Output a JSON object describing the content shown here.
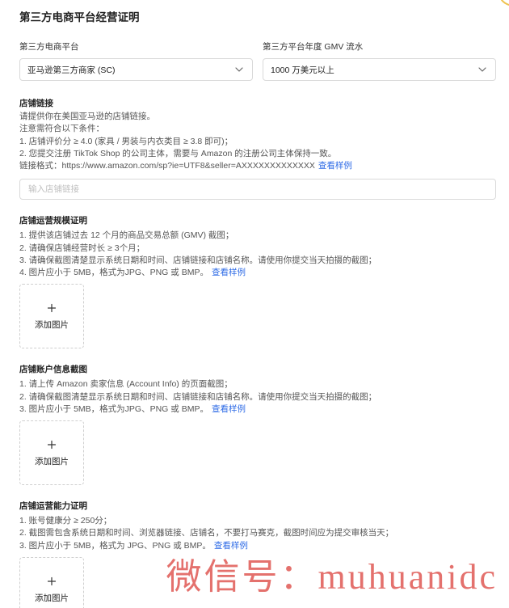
{
  "page": {
    "title": "第三方电商平台经营证明"
  },
  "platform_field": {
    "label": "第三方电商平台",
    "selected": "亚马逊第三方商家 (SC)",
    "icon": "chevron-down-icon"
  },
  "gmv_field": {
    "label": "第三方平台年度 GMV 流水",
    "selected": "1000 万美元以上",
    "icon": "chevron-down-icon"
  },
  "store_link": {
    "title": "店铺链接",
    "lines": [
      "请提供你在美国亚马逊的店铺链接。",
      "注意需符合以下条件：",
      "1. 店铺评价分 ≥ 4.0 (家具 / 男装与内衣类目 ≥ 3.8 即可)；",
      "2. 您提交注册 TikTok Shop 的公司主体，需要与 Amazon 的注册公司主体保持一致。"
    ],
    "format_line": "链接格式：https://www.amazon.com/sp?ie=UTF8&seller=AXXXXXXXXXXXXX",
    "sample_link": "查看样例",
    "input_placeholder": "输入店铺链接"
  },
  "scale_proof": {
    "title": "店铺运营规模证明",
    "lines": [
      "1. 提供该店铺过去 12 个月的商品交易总额 (GMV) 截图；",
      "2. 请确保店铺经营时长 ≥ 3个月；",
      "3. 请确保截图清楚显示系统日期和时间、店铺链接和店铺名称。请使用你提交当天拍摄的截图；"
    ],
    "last_line": "4. 图片应小于 5MB，格式为JPG、PNG 或 BMP。",
    "sample_link": "查看样例",
    "upload": {
      "icon": "plus-icon",
      "label": "添加图片"
    }
  },
  "account_info": {
    "title": "店铺账户信息截图",
    "lines": [
      "1. 请上传 Amazon 卖家信息 (Account Info) 的页面截图；",
      "2. 请确保截图清楚显示系统日期和时间、店铺链接和店铺名称。请使用你提交当天拍摄的截图；"
    ],
    "last_line": "3. 图片应小于 5MB，格式为JPG、PNG 或 BMP。",
    "sample_link": "查看样例",
    "upload": {
      "icon": "plus-icon",
      "label": "添加图片"
    }
  },
  "capability_proof": {
    "title": "店铺运营能力证明",
    "lines": [
      "1. 账号健康分 ≥ 250分；",
      "2. 截图需包含系统日期和时间、浏览器链接、店铺名，不要打马赛克，截图时间应为提交审核当天；"
    ],
    "last_line": "3. 图片应小于 5MB，格式为 JPG、PNG 或 BMP。",
    "sample_link": "查看样例",
    "upload": {
      "icon": "plus-icon",
      "label": "添加图片"
    }
  },
  "watermark": "微信号：muhuanidc",
  "colors": {
    "link": "#2e6be6",
    "watermark": "#e4716d",
    "border": "#d9d9d9",
    "decoration": "#efc250"
  }
}
